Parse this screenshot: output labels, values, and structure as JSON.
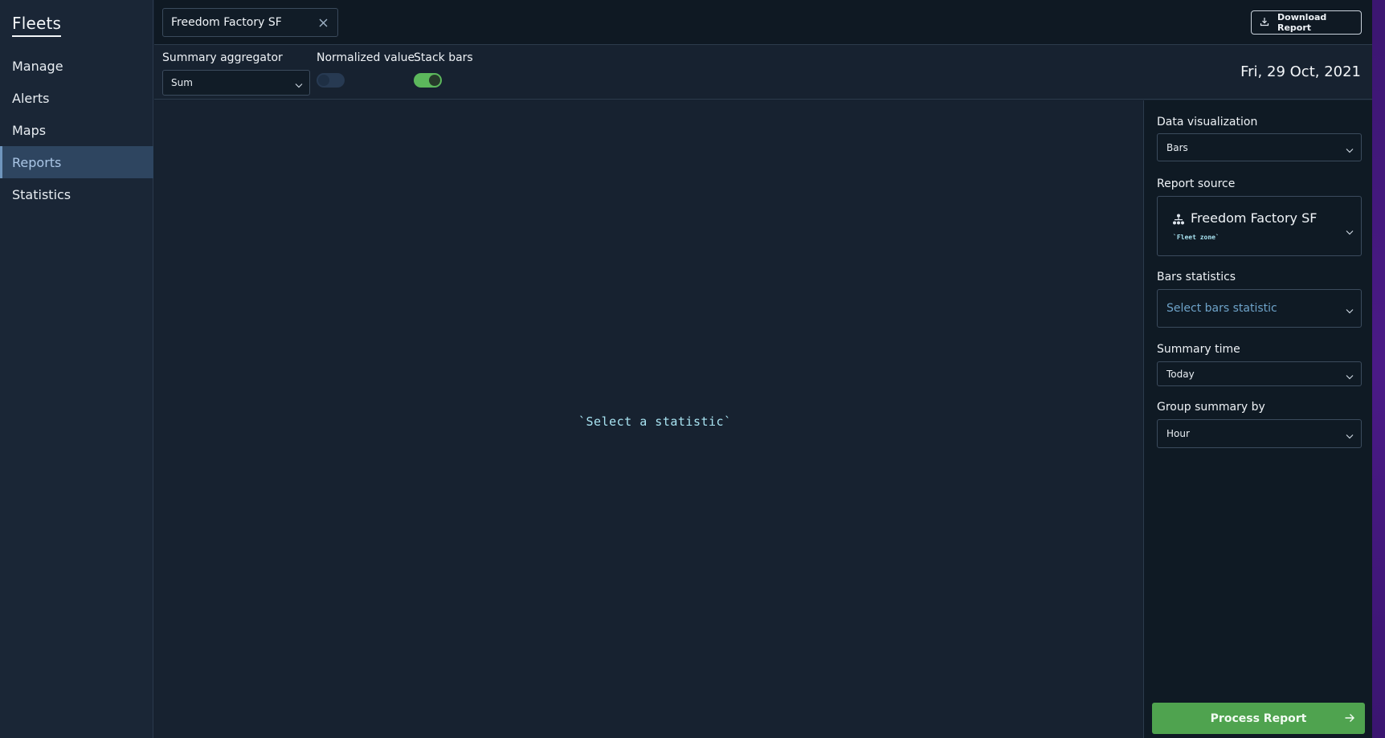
{
  "sidebar": {
    "brand": "Fleets",
    "items": [
      {
        "label": "Manage"
      },
      {
        "label": "Alerts"
      },
      {
        "label": "Maps"
      },
      {
        "label": "Reports",
        "active": true
      },
      {
        "label": "Statistics"
      }
    ]
  },
  "topbar": {
    "search_value": "Freedom Factory SF",
    "download_label": "Download Report"
  },
  "controls": {
    "aggregator_label": "Summary aggregator",
    "aggregator_value": "Sum",
    "normalized_label": "Normalized value",
    "normalized_on": false,
    "stack_label": "Stack bars",
    "stack_on": true,
    "date": "Fri, 29 Oct, 2021"
  },
  "main": {
    "empty_message": "`Select a statistic`"
  },
  "right_panel": {
    "viz_label": "Data visualization",
    "viz_value": "Bars",
    "source_label": "Report source",
    "source_name": "Freedom Factory SF",
    "source_type": "`Fleet zone`",
    "bars_stats_label": "Bars statistics",
    "bars_stats_placeholder": "Select bars statistic",
    "summary_time_label": "Summary time",
    "summary_time_value": "Today",
    "group_by_label": "Group summary by",
    "group_by_value": "Hour",
    "process_label": "Process Report"
  },
  "colors": {
    "accent_green": "#4fa34f",
    "active_nav_bg": "#2e4560",
    "mono_text": "#a9e4f2"
  }
}
